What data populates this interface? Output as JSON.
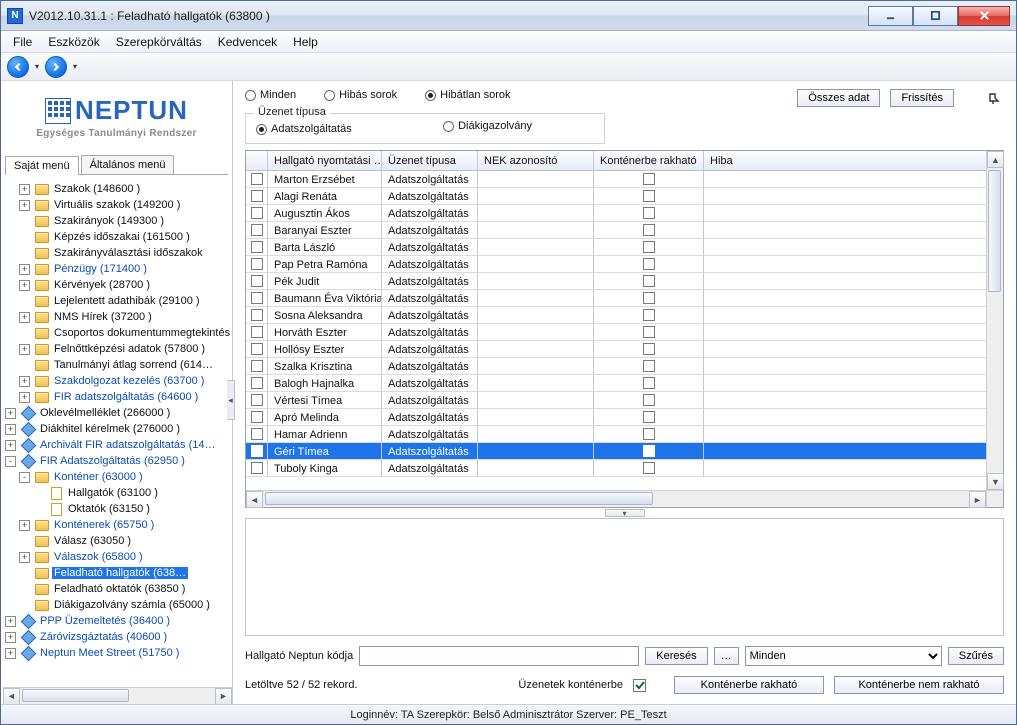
{
  "window": {
    "title": "V2012.10.31.1 : Feladható hallgatók (63800  )",
    "app_glyph": "N"
  },
  "menu": {
    "items": [
      "File",
      "Eszközök",
      "Szerepkörváltás",
      "Kedvencek",
      "Help"
    ]
  },
  "branding": {
    "name": "NEPTUN",
    "tagline": "Egységes Tanulmányi Rendszer"
  },
  "sidebar_tabs": {
    "own": "Saját menü",
    "general": "Általános menü"
  },
  "tree": [
    {
      "depth": 1,
      "exp": "+",
      "icon": "folder",
      "label": "Szakok (148600  )"
    },
    {
      "depth": 1,
      "exp": "+",
      "icon": "folder",
      "label": "Virtuális szakok (149200  )"
    },
    {
      "depth": 1,
      "exp": "",
      "icon": "folder",
      "label": "Szakirányok (149300  )"
    },
    {
      "depth": 1,
      "exp": "",
      "icon": "folder",
      "label": "Képzés időszakai (161500  )"
    },
    {
      "depth": 1,
      "exp": "",
      "icon": "folder",
      "label": "Szakirányválasztási időszakok"
    },
    {
      "depth": 1,
      "exp": "+",
      "icon": "folder",
      "label": "Pénzügy (171400  )",
      "blue": true
    },
    {
      "depth": 1,
      "exp": "+",
      "icon": "folder",
      "label": "Kérvények (28700  )"
    },
    {
      "depth": 1,
      "exp": "",
      "icon": "folder",
      "label": "Lejelentett adathibák (29100  )"
    },
    {
      "depth": 1,
      "exp": "+",
      "icon": "folder",
      "label": "NMS Hírek (37200  )"
    },
    {
      "depth": 1,
      "exp": "",
      "icon": "folder",
      "label": "Csoportos dokumentummegtekintés"
    },
    {
      "depth": 1,
      "exp": "+",
      "icon": "folder",
      "label": "Felnőttképzési adatok (57800  )"
    },
    {
      "depth": 1,
      "exp": "",
      "icon": "folder",
      "label": "Tanulmányi átlag sorrend (614…"
    },
    {
      "depth": 1,
      "exp": "+",
      "icon": "folder",
      "label": "Szakdolgozat kezelés (63700  )",
      "blue": true
    },
    {
      "depth": 1,
      "exp": "+",
      "icon": "folder",
      "label": "FIR adatszolgáltatás (64600  )",
      "blue": true
    },
    {
      "depth": 0,
      "exp": "+",
      "icon": "diamond",
      "label": "Oklevélmelléklet (266000  )"
    },
    {
      "depth": 0,
      "exp": "+",
      "icon": "diamond",
      "label": "Diákhitel kérelmek (276000  )"
    },
    {
      "depth": 0,
      "exp": "+",
      "icon": "diamond",
      "label": "Archivált FIR adatszolgáltatás (14…",
      "blue": true
    },
    {
      "depth": 0,
      "exp": "-",
      "icon": "diamond",
      "label": "FIR Adatszolgáltatás (62950  )",
      "blue": true
    },
    {
      "depth": 1,
      "exp": "-",
      "icon": "folder",
      "label": "Konténer (63000  )",
      "blue": true
    },
    {
      "depth": 2,
      "exp": "",
      "icon": "page",
      "label": "Hallgatók (63100  )"
    },
    {
      "depth": 2,
      "exp": "",
      "icon": "page",
      "label": "Oktatók (63150  )"
    },
    {
      "depth": 1,
      "exp": "+",
      "icon": "folder",
      "label": "Konténerek (65750  )",
      "blue": true
    },
    {
      "depth": 1,
      "exp": "",
      "icon": "folder",
      "label": "Válasz (63050  )"
    },
    {
      "depth": 1,
      "exp": "+",
      "icon": "folder",
      "label": "Válaszok (65800  )",
      "blue": true
    },
    {
      "depth": 1,
      "exp": "",
      "icon": "folder",
      "label": "Feladható hallgatók (638…",
      "selected": true
    },
    {
      "depth": 1,
      "exp": "",
      "icon": "folder",
      "label": "Feladható oktatók (63850  )"
    },
    {
      "depth": 1,
      "exp": "",
      "icon": "folder",
      "label": "Diákigazolvány számla (65000  )"
    },
    {
      "depth": 0,
      "exp": "+",
      "icon": "diamond",
      "label": "PPP Üzemeltetés (36400  )",
      "blue": true
    },
    {
      "depth": 0,
      "exp": "+",
      "icon": "diamond",
      "label": "Záróvizsgáztatás (40600  )",
      "blue": true
    },
    {
      "depth": 0,
      "exp": "+",
      "icon": "diamond",
      "label": "Neptun Meet Street (51750  )",
      "blue": true
    }
  ],
  "filters": {
    "minden": "Minden",
    "hibas": "Hibás sorok",
    "hibatlan": "Hibátlan sorok",
    "osszes_btn": "Összes adat",
    "frissites_btn": "Frissítés"
  },
  "msgtype": {
    "legend": "Üzenet típusa",
    "adat": "Adatszolgáltatás",
    "diak": "Diákigazolvány"
  },
  "grid": {
    "headers": {
      "cb": "",
      "name": "Hallgató nyomtatási …",
      "type": "Üzenet típusa",
      "nek": "NEK azonosító",
      "kont": "Konténerbe rakható",
      "hiba": "Hiba"
    },
    "rows": [
      {
        "name": "Marton Erzsébet",
        "type": "Adatszolgáltatás"
      },
      {
        "name": "Alagi Renáta",
        "type": "Adatszolgáltatás"
      },
      {
        "name": "Augusztin Ákos",
        "type": "Adatszolgáltatás"
      },
      {
        "name": "Baranyai Eszter",
        "type": "Adatszolgáltatás"
      },
      {
        "name": "Barta László",
        "type": "Adatszolgáltatás"
      },
      {
        "name": "Pap Petra Ramóna",
        "type": "Adatszolgáltatás"
      },
      {
        "name": "Pék Judit",
        "type": "Adatszolgáltatás"
      },
      {
        "name": "Baumann Éva Viktória",
        "type": "Adatszolgáltatás"
      },
      {
        "name": "Sosna Aleksandra",
        "type": "Adatszolgáltatás"
      },
      {
        "name": "Horváth Eszter",
        "type": "Adatszolgáltatás"
      },
      {
        "name": "Hollósy Eszter",
        "type": "Adatszolgáltatás"
      },
      {
        "name": "Szalka Krisztina",
        "type": "Adatszolgáltatás"
      },
      {
        "name": "Balogh Hajnalka",
        "type": "Adatszolgáltatás"
      },
      {
        "name": "Vértesi Tímea",
        "type": "Adatszolgáltatás"
      },
      {
        "name": "Apró Melinda",
        "type": "Adatszolgáltatás"
      },
      {
        "name": "Hamar Adrienn",
        "type": "Adatszolgáltatás"
      },
      {
        "name": "Géri Tímea",
        "type": "Adatszolgáltatás",
        "selected": true
      },
      {
        "name": "Tuboly Kinga",
        "type": "Adatszolgáltatás"
      }
    ]
  },
  "search": {
    "label": "Hallgató Neptun kódja",
    "value": "",
    "btn": "Keresés",
    "more": "…",
    "dropdown": "Minden",
    "filter_btn": "Szűrés"
  },
  "footer": {
    "records": "Letöltve 52 / 52 rekord.",
    "chk_label": "Üzenetek konténerbe",
    "btn_yes": "Konténerbe rakható",
    "btn_no": "Konténerbe nem rakható"
  },
  "status": "Loginnév: TA   Szerepkör: Belső Adminisztrátor   Szerver: PE_Teszt"
}
